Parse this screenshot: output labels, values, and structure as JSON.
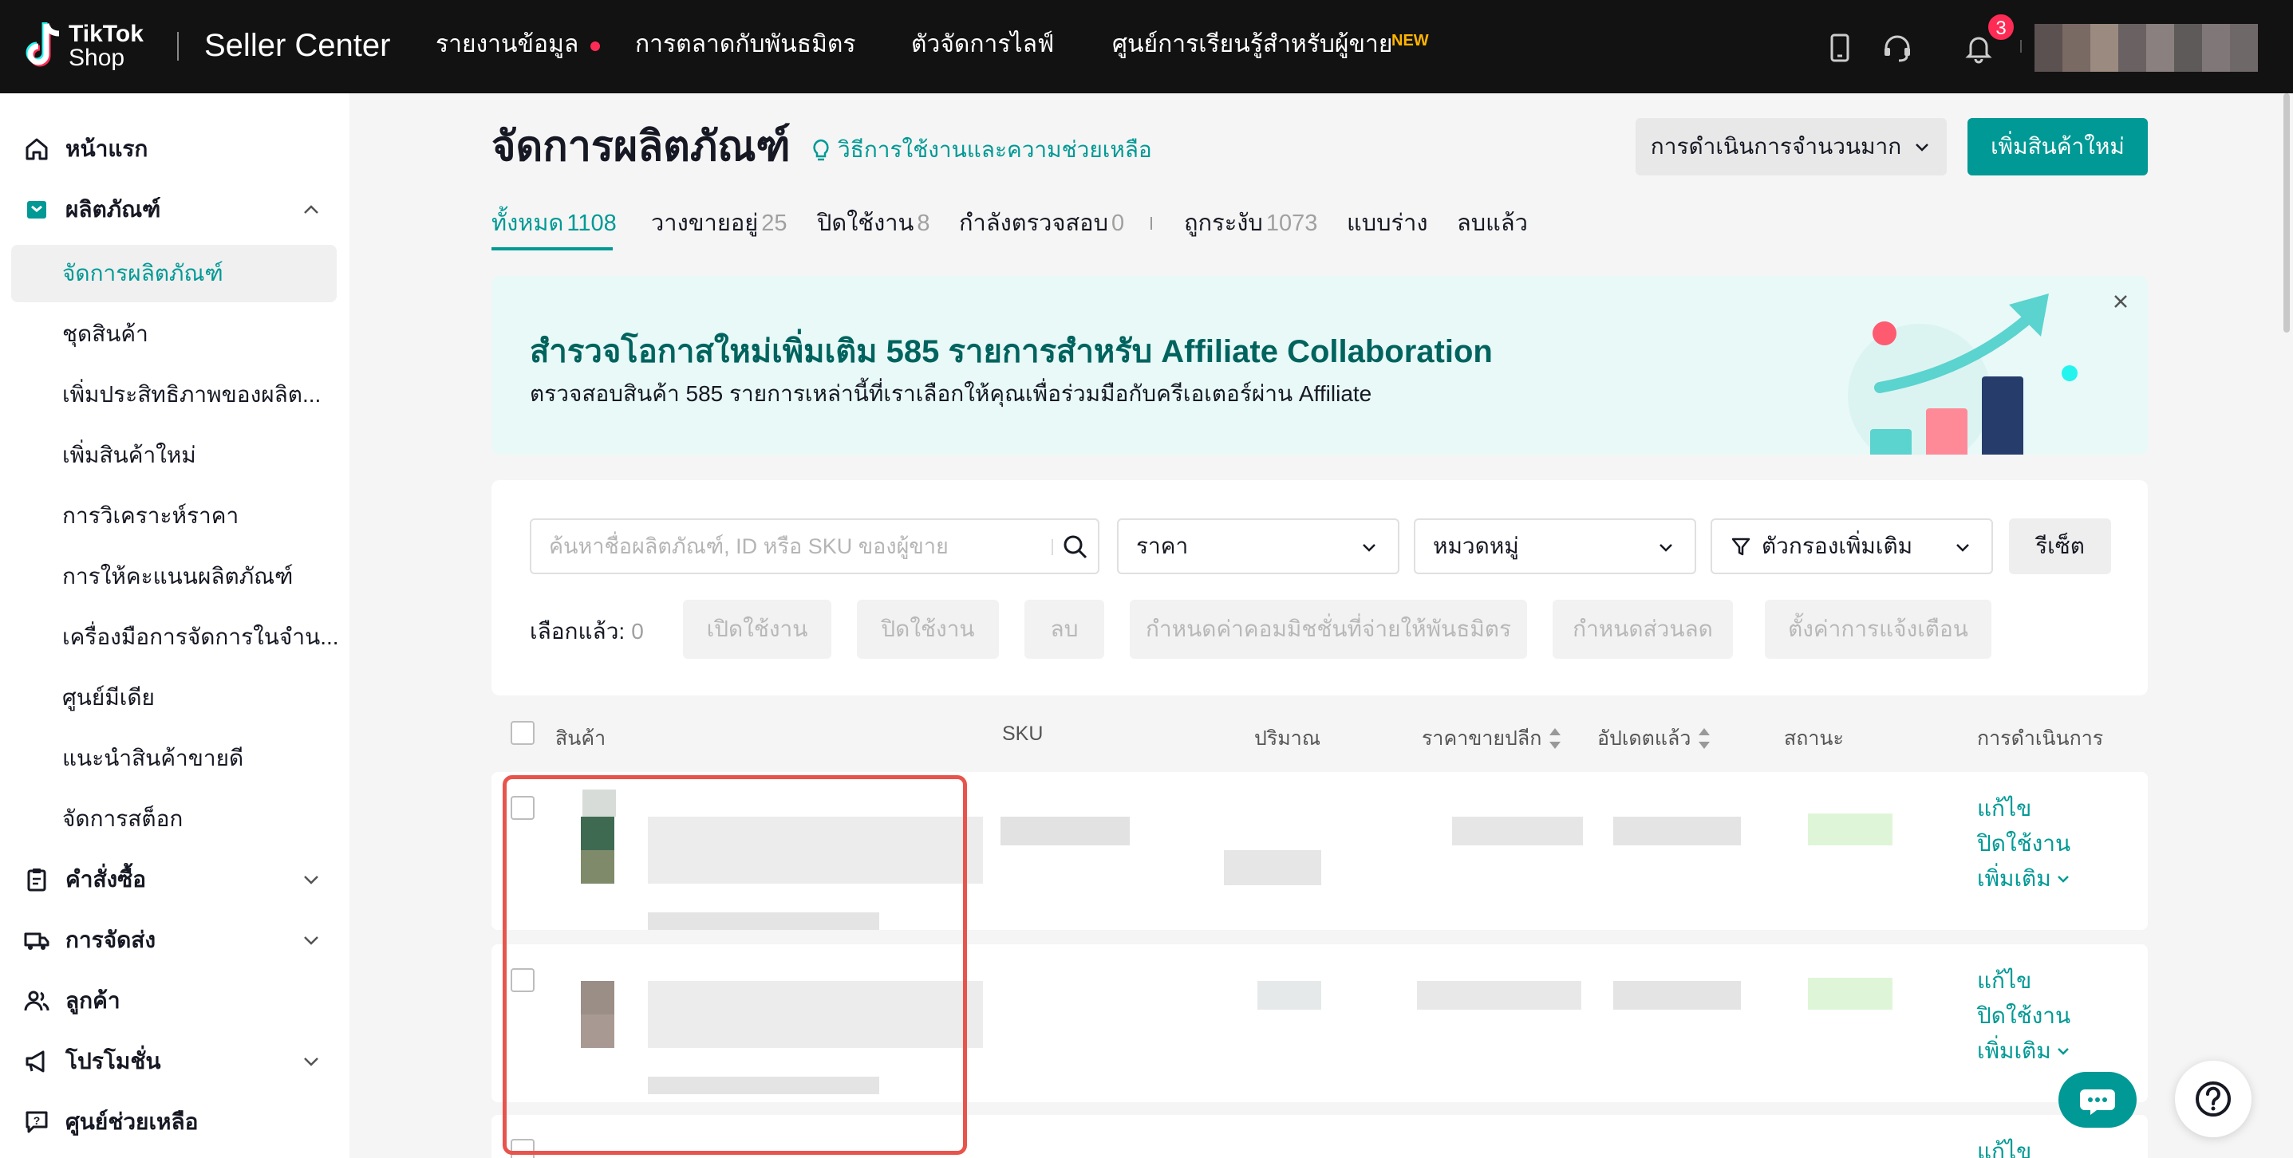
{
  "app": {
    "logo_text_line1": "TikTok",
    "logo_text_line2": "Shop",
    "product_name": "Seller Center"
  },
  "topnav": {
    "items": [
      {
        "label": "รายงานข้อมูล"
      },
      {
        "label": "การตลาดกับพันธมิตร"
      },
      {
        "label": "ตัวจัดการไลฟ์"
      },
      {
        "label": "ศูนย์การเรียนรู้สำหรับผู้ขาย"
      }
    ],
    "new_badge": "NEW",
    "notification_count": "3",
    "icons": [
      "phone-icon",
      "headset-icon",
      "bell-icon"
    ]
  },
  "sidebar": {
    "items": [
      {
        "label": "หน้าแรก",
        "icon": "home-icon"
      },
      {
        "label": "ผลิตภัณฑ์",
        "icon": "product-icon"
      },
      {
        "label": "จัดการผลิตภัณฑ์"
      },
      {
        "label": "ชุดสินค้า"
      },
      {
        "label": "เพิ่มประสิทธิภาพของผลิต..."
      },
      {
        "label": "เพิ่มสินค้าใหม่"
      },
      {
        "label": "การวิเคราะห์ราคา"
      },
      {
        "label": "การให้คะแนนผลิตภัณฑ์"
      },
      {
        "label": "เครื่องมือการจัดการในจำน..."
      },
      {
        "label": "ศูนย์มีเดีย"
      },
      {
        "label": "แนะนำสินค้าขายดี"
      },
      {
        "label": "จัดการสต็อก"
      },
      {
        "label": "คำสั่งซื้อ",
        "icon": "clipboard-icon"
      },
      {
        "label": "การจัดส่ง",
        "icon": "truck-icon"
      },
      {
        "label": "ลูกค้า",
        "icon": "users-icon"
      },
      {
        "label": "โปรโมชั่น",
        "icon": "megaphone-icon"
      },
      {
        "label": "ศูนย์ช่วยเหลือ",
        "icon": "help-chat-icon"
      }
    ]
  },
  "page": {
    "title": "จัดการผลิตภัณฑ์",
    "help_link": "วิธีการใช้งานและความช่วยเหลือ",
    "bulk_action_label": "การดำเนินการจำนวนมาก",
    "add_product_label": "เพิ่มสินค้าใหม่"
  },
  "tabs": [
    {
      "label": "ทั้งหมด",
      "count": "1108"
    },
    {
      "label": "วางขายอยู่",
      "count": "25"
    },
    {
      "label": "ปิดใช้งาน",
      "count": "8"
    },
    {
      "label": "กำลังตรวจสอบ",
      "count": "0"
    },
    {
      "label": "ถูกระงับ",
      "count": "1073"
    },
    {
      "label": "แบบร่าง",
      "count": ""
    },
    {
      "label": "ลบแล้ว",
      "count": ""
    }
  ],
  "banner": {
    "title": "สำรวจโอกาสใหม่เพิ่มเติม 585 รายการสำหรับ Affiliate Collaboration",
    "subtitle": "ตรวจสอบสินค้า 585 รายการเหล่านี้ที่เราเลือกให้คุณเพื่อร่วมมือกับครีเอเตอร์ผ่าน Affiliate"
  },
  "filters": {
    "search_placeholder": "ค้นหาชื่อผลิตภัณฑ์, ID หรือ SKU ของผู้ขาย",
    "price_label": "ราคา",
    "category_label": "หมวดหมู่",
    "more_filters_label": "ตัวกรองเพิ่มเติม",
    "reset_label": "รีเซ็ต",
    "selected_label": "เลือกแล้ว:",
    "selected_count": "0",
    "bulk_buttons": [
      {
        "label": "เปิดใช้งาน"
      },
      {
        "label": "ปิดใช้งาน"
      },
      {
        "label": "ลบ"
      },
      {
        "label": "กำหนดค่าคอมมิชชั่นที่จ่ายให้พันธมิตร"
      },
      {
        "label": "กำหนดส่วนลด"
      },
      {
        "label": "ตั้งค่าการแจ้งเตือน"
      }
    ]
  },
  "table": {
    "columns": [
      "สินค้า",
      "SKU",
      "ปริมาณ",
      "ราคาขายปลีก",
      "อัปเดตแล้ว",
      "สถานะ",
      "การดำเนินการ"
    ],
    "row_actions": {
      "edit": "แก้ไข",
      "disable": "ปิดใช้งาน",
      "more": "เพิ่มเติม"
    }
  },
  "colors": {
    "brand": "#009995",
    "topbar": "#121212",
    "badge": "#fe2c55",
    "highlight_border": "#e8544c"
  }
}
